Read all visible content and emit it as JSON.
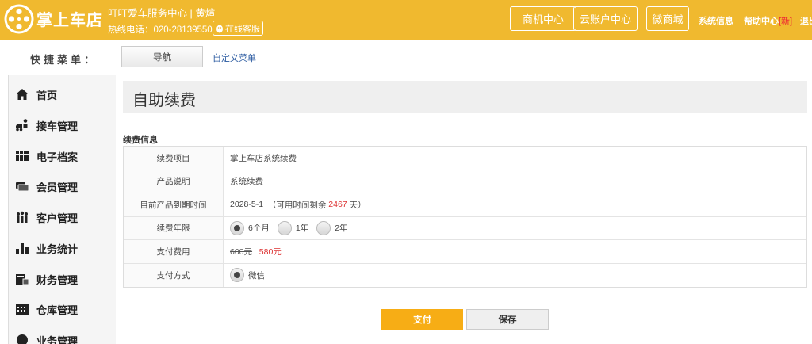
{
  "header": {
    "brand": "掌上车店",
    "store_name": "叮叮爱车服务中心 | 黄煊",
    "hotline": "热线电话：020-28139550",
    "online_service": "在线客服",
    "buttons": [
      "商机中心",
      "云账户中心",
      "微商城"
    ],
    "links": {
      "system_info": "系统信息",
      "help_center": "帮助中心",
      "new_tag": "[新]",
      "logout": "退出"
    }
  },
  "quick_menu": {
    "label": "快捷菜单：",
    "nav_button": "导航",
    "custom_link": "自定义菜单"
  },
  "sidebar": {
    "items": [
      {
        "label": "首页",
        "icon": "home-icon"
      },
      {
        "label": "接车管理",
        "icon": "car-reception-icon"
      },
      {
        "label": "电子档案",
        "icon": "archive-icon"
      },
      {
        "label": "会员管理",
        "icon": "member-card-icon"
      },
      {
        "label": "客户管理",
        "icon": "customers-icon"
      },
      {
        "label": "业务统计",
        "icon": "bar-chart-icon"
      },
      {
        "label": "财务管理",
        "icon": "finance-icon"
      },
      {
        "label": "仓库管理",
        "icon": "warehouse-icon"
      },
      {
        "label": "业务管理",
        "icon": "business-icon"
      }
    ]
  },
  "main": {
    "page_title": "自助续费",
    "section_title": "续费信息",
    "rows": {
      "item": {
        "label": "续费项目",
        "value": "掌上车店系统续费"
      },
      "desc": {
        "label": "产品说明",
        "value": "系统续费"
      },
      "expiry": {
        "label": "目前产品到期时间",
        "date": "2028-5-1",
        "remain_prefix": "（可用时间剩余",
        "remain_days": "2467",
        "remain_suffix": "天）"
      },
      "period": {
        "label": "续费年限",
        "options": [
          "6个月",
          "1年",
          "2年"
        ],
        "selected": "6个月"
      },
      "fee": {
        "label": "支付费用",
        "original": "600元",
        "price": "580元"
      },
      "method": {
        "label": "支付方式",
        "option": "微信"
      }
    },
    "pay_button": "支付",
    "save_button": "保存"
  },
  "colors": {
    "accent": "#f0b92f",
    "pay": "#f7ad15",
    "price": "#d33333"
  }
}
